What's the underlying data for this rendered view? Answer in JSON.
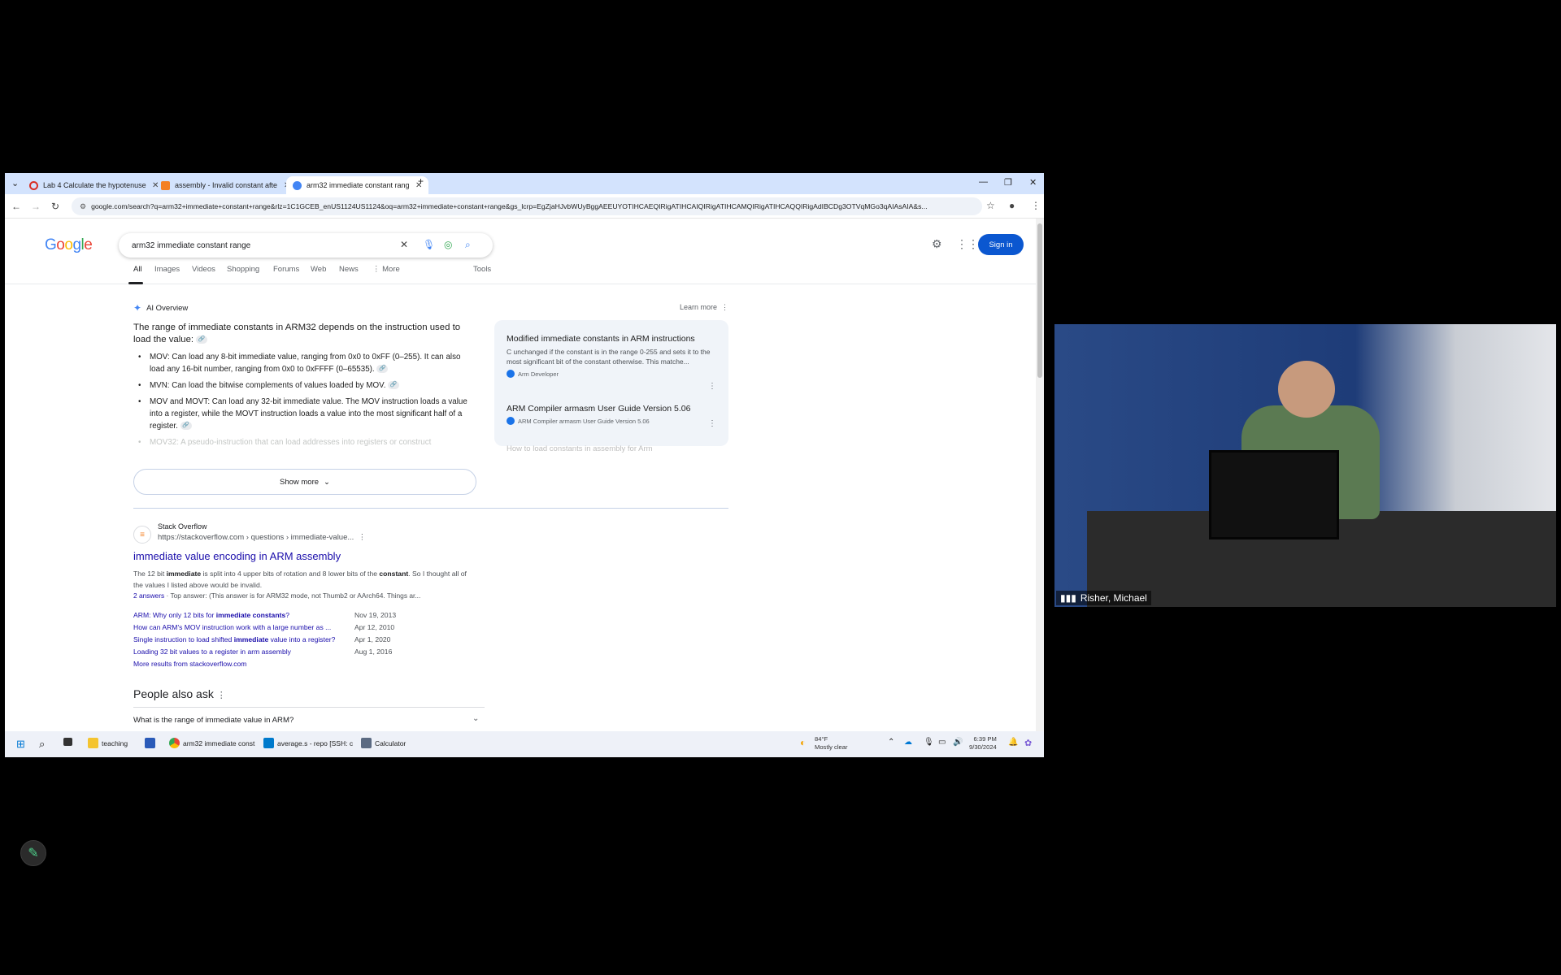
{
  "browser": {
    "tabs": [
      {
        "label": "Lab 4 Calculate the hypotenuse",
        "color": "#d93025"
      },
      {
        "label": "assembly - Invalid constant afte",
        "color": "#f48024"
      },
      {
        "label": "arm32 immediate constant rang",
        "color": "#4285f4"
      }
    ],
    "new_tab": "+",
    "url": "google.com/search?q=arm32+immediate+constant+range&rlz=1C1GCEB_enUS1124US1124&oq=arm32+immediate+constant+range&gs_lcrp=EgZjaHJvbWUyBggAEEUYOTIHCAEQIRigATIHCAIQIRigATIHCAMQIRigATIHCAQQIRigAdIBCDg3OTVqMGo3qAIAsAIA&s..."
  },
  "google": {
    "logo": "Google",
    "query": "arm32 immediate constant range",
    "signin": "Sign in",
    "nav": [
      "All",
      "Images",
      "Videos",
      "Shopping",
      "Forums",
      "Web",
      "News",
      "⋮ More",
      "Tools"
    ],
    "ai_label": "AI Overview",
    "learn_more": "Learn more",
    "ai_intro": "The range of immediate constants in ARM32 depends on the instruction used to load the value:",
    "ai_items": [
      "MOV: Can load any 8-bit immediate value, ranging from 0x0 to 0xFF (0–255). It can also load any 16-bit number, ranging from 0x0 to 0xFFFF (0–65535).",
      "MVN: Can load the bitwise complements of values loaded by MOV.",
      "MOV and MOVT: Can load any 32-bit immediate value. The MOV instruction loads a value into a register, while the MOVT instruction loads a value into the most significant half of a register.",
      "MOV32: A pseudo-instruction that can load addresses into registers or construct"
    ],
    "show_more": "Show more",
    "cards": [
      {
        "title": "Modified immediate constants in ARM instructions",
        "snippet": "C unchanged if the constant is in the range 0-255 and sets it to the most significant bit of the constant otherwise. This matche...",
        "source": "Arm Developer"
      },
      {
        "title": "ARM Compiler armasm User Guide Version 5.06",
        "snippet": "",
        "source": "ARM Compiler armasm User Guide Version 5.06"
      },
      {
        "title": "How to load constants in assembly for Arm",
        "snippet": "",
        "source": ""
      }
    ],
    "result": {
      "site": "Stack Overflow",
      "url": "https://stackoverflow.com › questions › immediate-value...",
      "title": "immediate value encoding in ARM assembly",
      "snippet_a": "The 12 bit ",
      "snippet_b": "immediate",
      "snippet_c": " is split into 4 upper bits of rotation and 8 lower bits of the ",
      "snippet_d": "constant",
      "snippet_e": ". So I thought all of the values I listed above would be invalid.",
      "answers": "2 answers",
      "top_answer": " · Top answer: ",
      "top_answer_text": "(This answer is for ARM32 mode, not Thumb2 or AArch64. Things ar...",
      "questions": [
        {
          "pre": "ARM: Why only 12 bits for ",
          "bold": "immediate constants",
          "post": "?",
          "date": "Nov 19, 2013"
        },
        {
          "pre": "How can ARM's MOV instruction work with a large number as ...",
          "bold": "",
          "post": "",
          "date": "Apr 12, 2010"
        },
        {
          "pre": "Single instruction to load shifted ",
          "bold": "immediate",
          "post": " value into a register?",
          "date": "Apr 1, 2020"
        },
        {
          "pre": "Loading 32 bit values to a register in arm assembly",
          "bold": "",
          "post": "",
          "date": "Aug 1, 2016"
        }
      ],
      "more": "More results from stackoverflow.com"
    },
    "paa_title": "People also ask",
    "paa_q": "What is the range of immediate value in ARM?"
  },
  "taskbar": {
    "items": [
      {
        "label": "teaching",
        "color": "#f4c430"
      },
      {
        "label": "",
        "color": "#2a5ab8"
      },
      {
        "label": "arm32 immediate const",
        "color": "#4285f4"
      },
      {
        "label": "average.s - repo [SSH: c",
        "color": "#007acc"
      },
      {
        "label": "Calculator",
        "color": "#5b6a82"
      }
    ],
    "weather_temp": "84°F",
    "weather_desc": "Mostly clear",
    "time": "6:39 PM",
    "date": "9/30/2024"
  },
  "video": {
    "name": "Risher, Michael"
  }
}
